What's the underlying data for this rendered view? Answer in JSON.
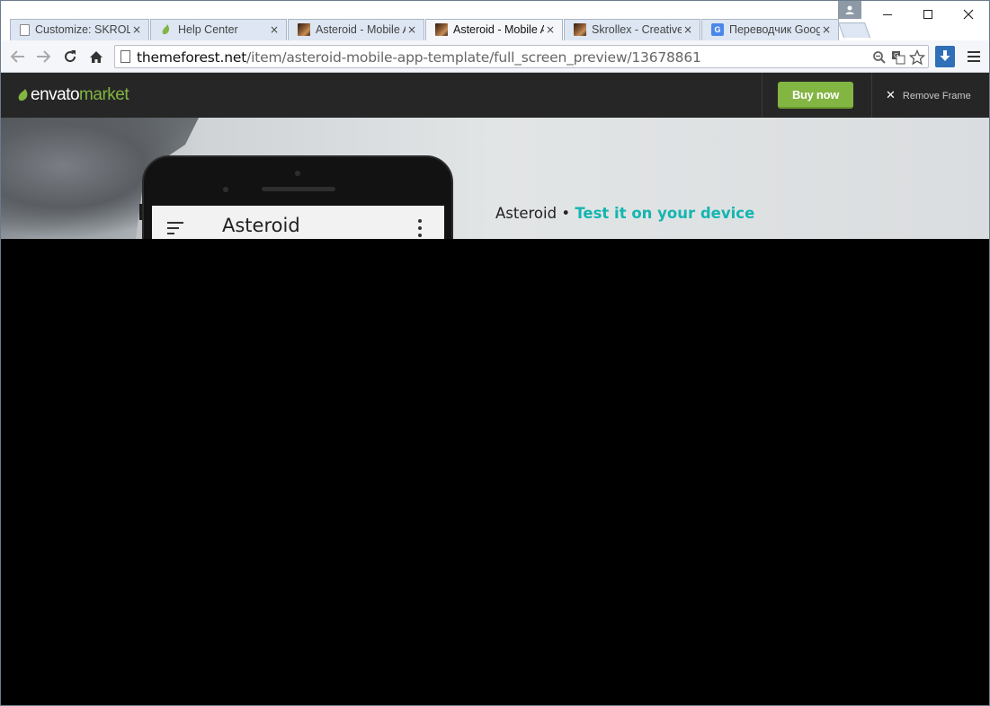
{
  "browser": {
    "tabs": [
      {
        "title": "Customize: SKROLL",
        "favicon": "document-icon",
        "close": "×"
      },
      {
        "title": "Help Center",
        "favicon": "envato-leaf-icon",
        "close": "×"
      },
      {
        "title": "Asteroid - Mobile A",
        "favicon": "asteroid-thumbnail-icon",
        "close": "×"
      },
      {
        "title": "Asteroid - Mobile A",
        "favicon": "asteroid-thumbnail-icon",
        "close": "×",
        "active": true
      },
      {
        "title": "Skrollex - Creative",
        "favicon": "skrollex-thumbnail-icon",
        "close": "×"
      },
      {
        "title": "Переводчик Google",
        "favicon": "google-translate-icon",
        "close": "×"
      }
    ],
    "window_controls": {
      "minimize": "—",
      "maximize": "☐",
      "close": "✕"
    },
    "address": {
      "host": "themeforest.net",
      "path": "/item/asteroid-mobile-app-template/full_screen_preview/13678861"
    },
    "toolbar_icons": [
      "back-arrow-icon",
      "forward-arrow-icon",
      "reload-icon",
      "home-icon",
      "zoom-icon",
      "translate-icon",
      "bookmark-star-icon",
      "download-icon",
      "menu-icon"
    ]
  },
  "envato_bar": {
    "logo_part1": "envato",
    "logo_part2": "market",
    "buy_label": "Buy now",
    "remove_frame_icon": "✕",
    "remove_frame_label": "Remove Frame",
    "accent_color": "#82b541"
  },
  "preview": {
    "app_title": "Asteroid",
    "headline_name": "Asteroid",
    "headline_sep": " • ",
    "headline_link": "Test it on your device",
    "link_color": "#15b5b0"
  }
}
